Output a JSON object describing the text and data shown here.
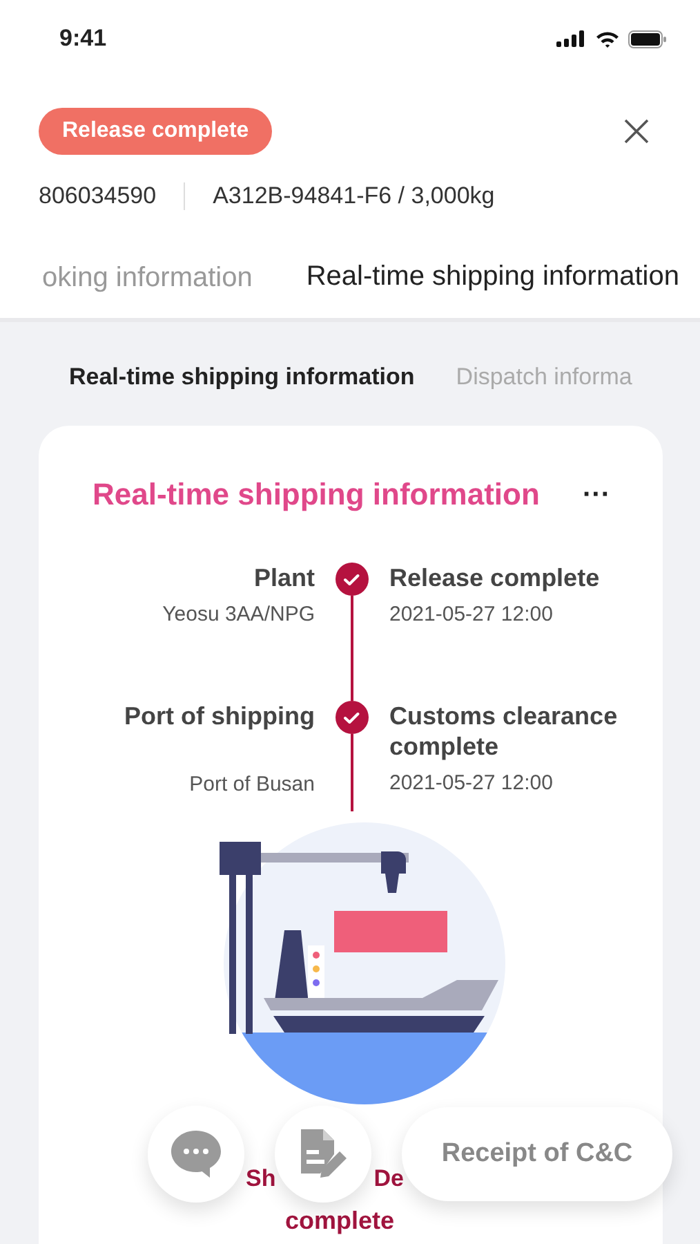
{
  "status_bar": {
    "time": "9:41"
  },
  "header": {
    "status_badge": "Release complete",
    "order_number": "806034590",
    "product": "A312B-94841-F6 / 3,000kg"
  },
  "tabs": [
    {
      "label": "oking information",
      "selected": false
    },
    {
      "label": "Real-time shipping information",
      "selected": true
    }
  ],
  "sub_tabs": [
    {
      "label": "Real-time shipping information",
      "selected": true
    },
    {
      "label": "Dispatch informa",
      "selected": false
    }
  ],
  "card": {
    "title": "Real-time shipping information",
    "more": "···",
    "steps": [
      {
        "place": "Plant",
        "location": "Yeosu 3AA/NPG",
        "status": "Release complete",
        "time": "2021-05-27 12:00",
        "done": true
      },
      {
        "place": "Port of shipping",
        "location": "Port of Busan",
        "status": "Customs clearance complete",
        "time": "2021-05-27 12:00",
        "done": true
      }
    ],
    "caption_fragments": [
      "Sh",
      "De"
    ],
    "caption_line": "complete"
  },
  "actions": {
    "receipt_button": "Receipt of C&C"
  }
}
